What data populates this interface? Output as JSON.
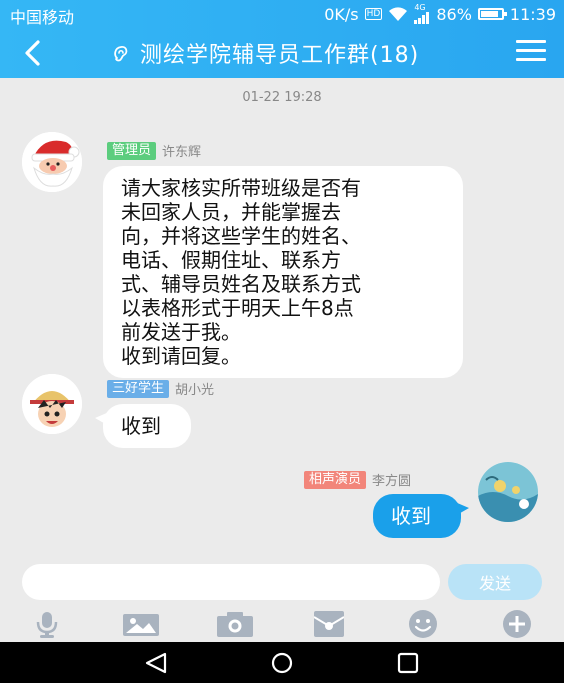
{
  "status_bar": {
    "carrier": "中国移动",
    "net_speed": "0K/s",
    "hd_badge": "HD",
    "network_type": "4G",
    "battery_percent": "86%",
    "battery_level": 0.86,
    "time": "11:39"
  },
  "header": {
    "title": "测绘学院辅导员工作群(18)",
    "title_icon": "ear-icon",
    "back_icon": "chevron-left-icon",
    "menu_icon": "hamburger-menu-icon"
  },
  "chat": {
    "timestamp": "01-22 19:28",
    "messages": [
      {
        "badge": "管理员",
        "badge_color": "#5ccd7e",
        "sender": "许东辉",
        "avatar": "santa-avatar",
        "lines": [
          "请大家核实所带班级是否有",
          "未回家人员，并能掌握去",
          "向，并将这些学生的姓名、",
          "电话、假期住址、联系方",
          "式、辅导员姓名及联系方式",
          "以表格形式于明天上午8点",
          "前发送于我。",
          "收到请回复。"
        ]
      },
      {
        "badge": "三好学生",
        "badge_color": "#6aaee8",
        "sender": "胡小光",
        "avatar": "cartoon-boy-avatar",
        "lines": [
          "收到"
        ]
      },
      {
        "badge": "相声演员",
        "badge_color": "#f2857a",
        "sender": "李方圆",
        "avatar": "painting-avatar",
        "lines": [
          "收到"
        ],
        "self": true
      }
    ]
  },
  "input": {
    "value": "",
    "placeholder": "",
    "send_label": "发送"
  },
  "toolbar": {
    "items": [
      "microphone-icon",
      "image-icon",
      "camera-icon",
      "red-packet-icon",
      "emoji-icon",
      "plus-icon"
    ]
  },
  "nav": {
    "items": [
      "back-triangle-icon",
      "home-circle-icon",
      "recents-square-icon"
    ]
  },
  "colors": {
    "accent": "#29a6f0",
    "self_bubble": "#1aa0ea",
    "background": "#ebebeb"
  }
}
